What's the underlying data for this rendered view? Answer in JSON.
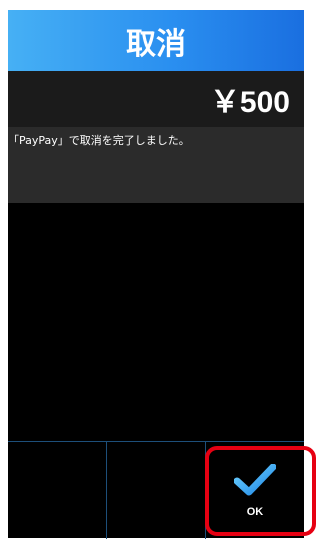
{
  "header": {
    "title": "取消"
  },
  "amount": {
    "text": "￥500"
  },
  "message": {
    "text": "「PayPay」で取消を完了しました。"
  },
  "bottom_bar": {
    "ok_label": "OK",
    "ok_icon": "checkmark-icon"
  },
  "colors": {
    "header_start": "#46b0f4",
    "header_end": "#1a6fe0",
    "highlight": "#e60012",
    "divider": "#1d4f7a",
    "check_light": "#6fd3ff",
    "check_dark": "#1e86e6"
  }
}
